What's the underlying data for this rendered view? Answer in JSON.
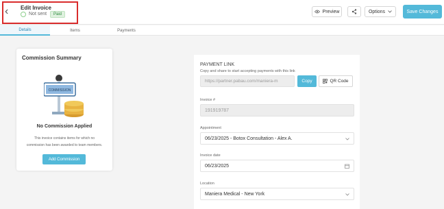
{
  "header": {
    "title": "Edit Invoice",
    "status": "Not sent",
    "badge": "Paid",
    "back_icon": "chevron-left-icon",
    "buttons": {
      "preview": "Preview",
      "options": "Options",
      "save": "Save Changes"
    }
  },
  "tabs": [
    "Details",
    "Items",
    "Payments"
  ],
  "commission": {
    "title": "Commission Summary",
    "illustration_label": "COMMISSION",
    "heading": "No Commission Applied",
    "description": "This invoice contains items for which no commission has been awarded to team members.",
    "button": "Add Commission"
  },
  "payment_link": {
    "title": "PAYMENT LINK",
    "description": "Copy and share to start accepting payments with this link",
    "url": "https://partner.pabau.com/maniera-m",
    "copy": "Copy",
    "qr": "QR Code"
  },
  "fields": {
    "invoice_label": "Invoice #",
    "invoice_value": "191919787",
    "appointment_label": "Appointment",
    "appointment_value": "06/23/2025 - Botox Consultation - Alex A.",
    "date_label": "Invoice date",
    "date_value": "06/23/2025",
    "location_label": "Location",
    "location_value": "Maniera Medical - New York"
  },
  "colors": {
    "accent": "#53b9d9",
    "highlight_box": "#d92b2b",
    "paid_green": "#2e8b3e"
  }
}
